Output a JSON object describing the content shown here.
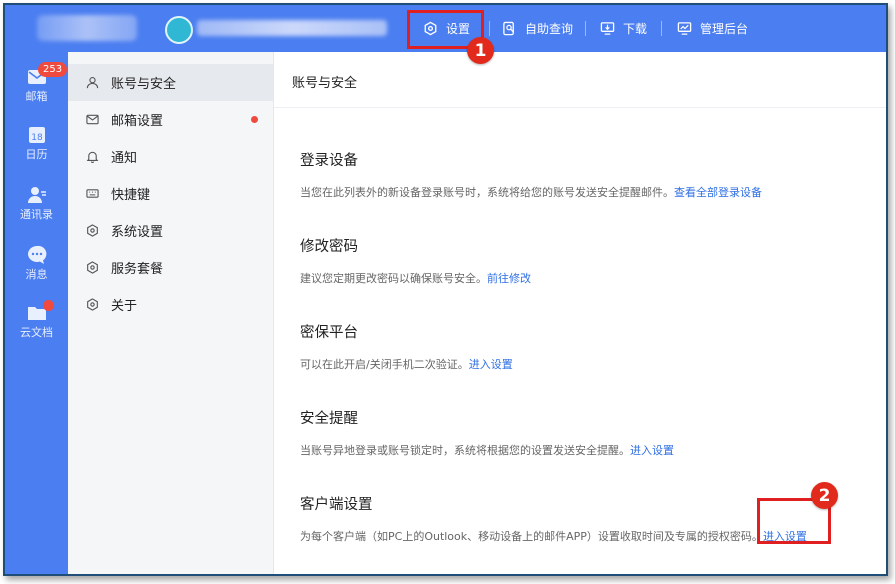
{
  "topbar": {
    "nav": [
      {
        "label": "设置",
        "icon": "gear-icon"
      },
      {
        "label": "自助查询",
        "icon": "search-doc-icon"
      },
      {
        "label": "下载",
        "icon": "monitor-download-icon"
      },
      {
        "label": "管理后台",
        "icon": "dashboard-icon"
      }
    ]
  },
  "rail": {
    "items": [
      {
        "label": "邮箱",
        "icon": "mail-icon",
        "badge": "253"
      },
      {
        "label": "日历",
        "icon": "calendar-icon",
        "day": "18"
      },
      {
        "label": "通讯录",
        "icon": "contacts-icon"
      },
      {
        "label": "消息",
        "icon": "chat-icon"
      },
      {
        "label": "云文档",
        "icon": "cloud-doc-icon"
      }
    ]
  },
  "menu": {
    "items": [
      {
        "label": "账号与安全",
        "icon": "user-icon",
        "active": true
      },
      {
        "label": "邮箱设置",
        "icon": "mail-outline-icon",
        "dot": true
      },
      {
        "label": "通知",
        "icon": "bell-icon"
      },
      {
        "label": "快捷键",
        "icon": "keyboard-icon"
      },
      {
        "label": "系统设置",
        "icon": "hex-gear-icon"
      },
      {
        "label": "服务套餐",
        "icon": "hex-gear-icon"
      },
      {
        "label": "关于",
        "icon": "hex-gear-icon"
      }
    ]
  },
  "content": {
    "title": "账号与安全",
    "sections": [
      {
        "title": "登录设备",
        "desc": "当您在此列表外的新设备登录账号时，系统将给您的账号发送安全提醒邮件。",
        "link": "查看全部登录设备"
      },
      {
        "title": "修改密码",
        "desc": "建议您定期更改密码以确保账号安全。",
        "link": "前往修改"
      },
      {
        "title": "密保平台",
        "desc": "可以在此开启/关闭手机二次验证。",
        "link": "进入设置"
      },
      {
        "title": "安全提醒",
        "desc": "当账号异地登录或账号锁定时，系统将根据您的设置发送安全提醒。",
        "link": "进入设置"
      },
      {
        "title": "客户端设置",
        "desc": "为每个客户端（如PC上的Outlook、移动设备上的邮件APP）设置收取时间及专属的授权密码。",
        "link": "进入设置"
      }
    ]
  },
  "annotations": {
    "marker_1": "1",
    "marker_2": "2",
    "highlight_color": "#e02020"
  },
  "colors": {
    "brand": "#4b7ef0",
    "link": "#2f6fe4",
    "badge": "#ef4a3d"
  }
}
